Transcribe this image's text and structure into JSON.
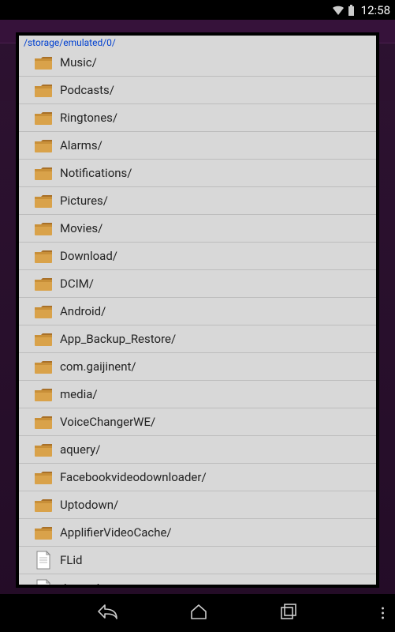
{
  "status": {
    "time": "12:58"
  },
  "dialog": {
    "path": "/storage/emulated/0/",
    "items": [
      {
        "type": "folder",
        "name": "Music/"
      },
      {
        "type": "folder",
        "name": "Podcasts/"
      },
      {
        "type": "folder",
        "name": "Ringtones/"
      },
      {
        "type": "folder",
        "name": "Alarms/"
      },
      {
        "type": "folder",
        "name": "Notifications/"
      },
      {
        "type": "folder",
        "name": "Pictures/"
      },
      {
        "type": "folder",
        "name": "Movies/"
      },
      {
        "type": "folder",
        "name": "Download/"
      },
      {
        "type": "folder",
        "name": "DCIM/"
      },
      {
        "type": "folder",
        "name": "Android/"
      },
      {
        "type": "folder",
        "name": "App_Backup_Restore/"
      },
      {
        "type": "folder",
        "name": "com.gaijinent/"
      },
      {
        "type": "folder",
        "name": "media/"
      },
      {
        "type": "folder",
        "name": "VoiceChangerWE/"
      },
      {
        "type": "folder",
        "name": "aquery/"
      },
      {
        "type": "folder",
        "name": "Facebookvideodownloader/"
      },
      {
        "type": "folder",
        "name": "Uptodown/"
      },
      {
        "type": "folder",
        "name": "ApplifierVideoCache/"
      },
      {
        "type": "file",
        "name": "FLid"
      },
      {
        "type": "file",
        "name": "data.ads"
      }
    ]
  }
}
